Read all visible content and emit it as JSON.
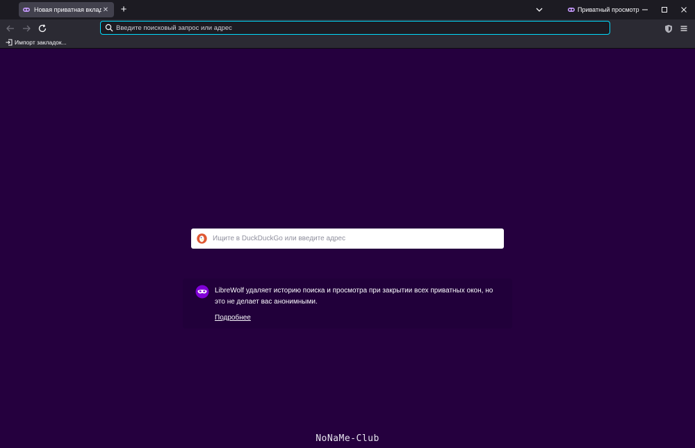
{
  "tab": {
    "title": "Новая приватная вкладка",
    "icon": "private-mask-icon"
  },
  "titlebar": {
    "private_label": "Приватный просмотр"
  },
  "urlbar": {
    "placeholder": "Введите поисковый запрос или адрес"
  },
  "bookmarks": {
    "items": [
      {
        "label": "Импорт закладок..."
      }
    ]
  },
  "content": {
    "search_placeholder": "Ищите в DuckDuckGo или введите адрес",
    "info_text": "LibreWolf удаляет историю поиска и просмотра при закрытии всех приватных окон, но это не делает вас анонимными.",
    "learn_more": "Подробнее",
    "watermark": "NoNaMe-Club"
  },
  "colors": {
    "accent": "#00ddff",
    "private_purple": "#8000d7",
    "content_bg": "#25003e",
    "chrome_bg": "#1c1b22",
    "toolbar_bg": "#2b2a33",
    "duckduckgo_orange": "#de5833"
  }
}
